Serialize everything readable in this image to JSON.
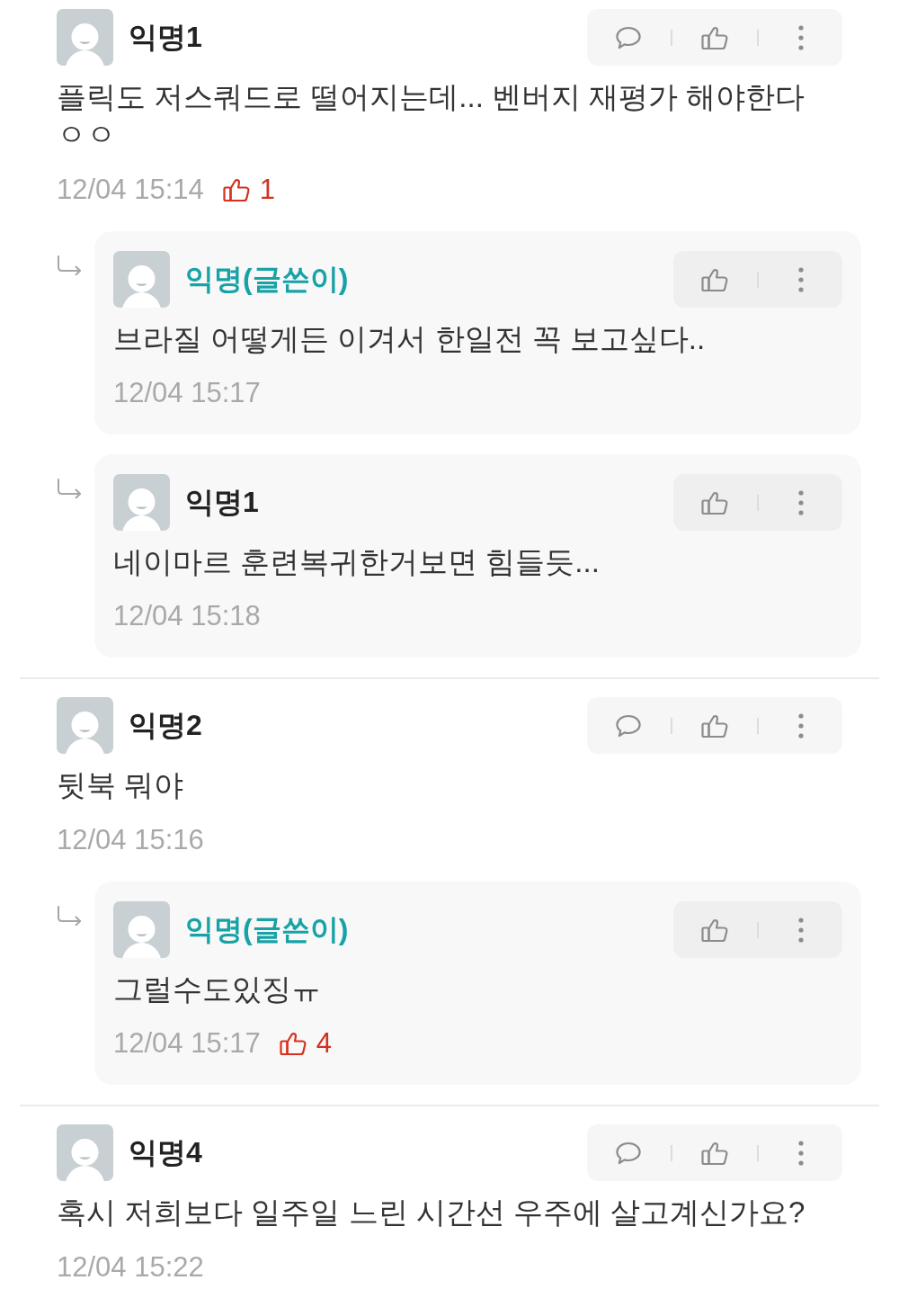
{
  "comments": [
    {
      "author": "익명1",
      "is_post_author": false,
      "body": "플릭도 저스쿼드로 떨어지는데... 벤버지 재평가 해야한다 ㅇㅇ",
      "time": "12/04 15:14",
      "likes": "1",
      "replies": [
        {
          "author": "익명(글쓴이)",
          "is_post_author": true,
          "body": "브라질 어떻게든 이겨서 한일전 꼭 보고싶다..",
          "time": "12/04 15:17"
        },
        {
          "author": "익명1",
          "is_post_author": false,
          "body": "네이마르 훈련복귀한거보면 힘들듯...",
          "time": "12/04 15:18"
        }
      ]
    },
    {
      "author": "익명2",
      "is_post_author": false,
      "body": "뒷북 뭐야",
      "time": "12/04 15:16",
      "replies": [
        {
          "author": "익명(글쓴이)",
          "is_post_author": true,
          "body": "그럴수도있징ㅠ",
          "time": "12/04 15:17",
          "likes": "4"
        }
      ]
    },
    {
      "author": "익명4",
      "is_post_author": false,
      "body": "혹시 저희보다 일주일 느린 시간선 우주에 살고계신가요?",
      "time": "12/04 15:22"
    }
  ]
}
